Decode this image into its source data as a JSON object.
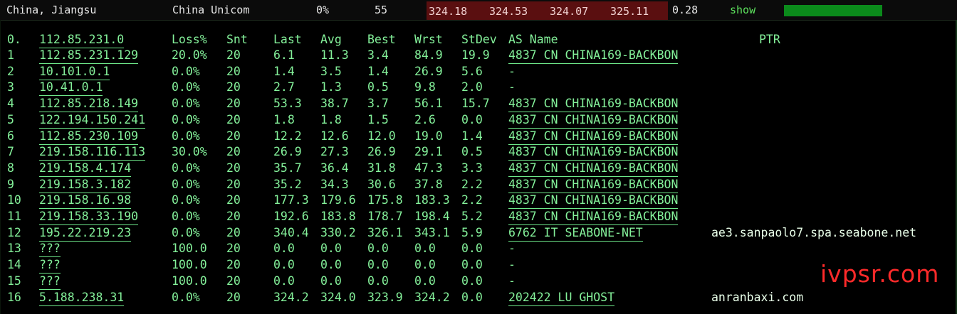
{
  "topbar": {
    "location": "China, Jiangsu",
    "isp": "China Unicom",
    "loss": "0%",
    "sent": "55",
    "pings": [
      "324.18",
      "324.53",
      "324.07",
      "325.11"
    ],
    "stdev": "0.28",
    "show_label": "show",
    "bar_fill": 1.0,
    "colors": {
      "ping_bg": "#5a0f10",
      "bar": "#0b8a1b",
      "text_green": "#5ee35e"
    }
  },
  "table": {
    "headers": {
      "num": "0.",
      "host": "112.85.231.0",
      "loss": "Loss%",
      "snt": "Snt",
      "last": "Last",
      "avg": "Avg",
      "best": "Best",
      "wrst": "Wrst",
      "stdev": "StDev",
      "asname": "AS Name",
      "ptr": "PTR"
    },
    "rows": [
      {
        "num": "1",
        "host": "112.85.231.129",
        "loss": "20.0%",
        "snt": "20",
        "last": "6.1",
        "avg": "11.3",
        "best": "3.4",
        "wrst": "84.9",
        "stdev": "19.9",
        "asname": "4837  CN CHINA169-BACKBON",
        "ptr": ""
      },
      {
        "num": "2",
        "host": "10.101.0.1",
        "loss": "0.0%",
        "snt": "20",
        "last": "1.4",
        "avg": "3.5",
        "best": "1.4",
        "wrst": "26.9",
        "stdev": "5.6",
        "asname": "-",
        "ptr": ""
      },
      {
        "num": "3",
        "host": "10.41.0.1",
        "loss": "0.0%",
        "snt": "20",
        "last": "2.7",
        "avg": "1.3",
        "best": "0.5",
        "wrst": "9.8",
        "stdev": "2.0",
        "asname": "-",
        "ptr": ""
      },
      {
        "num": "4",
        "host": "112.85.218.149",
        "loss": "0.0%",
        "snt": "20",
        "last": "53.3",
        "avg": "38.7",
        "best": "3.7",
        "wrst": "56.1",
        "stdev": "15.7",
        "asname": "4837  CN CHINA169-BACKBON",
        "ptr": ""
      },
      {
        "num": "5",
        "host": "122.194.150.241",
        "loss": "0.0%",
        "snt": "20",
        "last": "1.8",
        "avg": "1.8",
        "best": "1.5",
        "wrst": "2.6",
        "stdev": "0.0",
        "asname": "4837  CN CHINA169-BACKBON",
        "ptr": ""
      },
      {
        "num": "6",
        "host": "112.85.230.109",
        "loss": "0.0%",
        "snt": "20",
        "last": "12.2",
        "avg": "12.6",
        "best": "12.0",
        "wrst": "19.0",
        "stdev": "1.4",
        "asname": "4837  CN CHINA169-BACKBON",
        "ptr": ""
      },
      {
        "num": "7",
        "host": "219.158.116.113",
        "loss": "30.0%",
        "snt": "20",
        "last": "26.9",
        "avg": "27.3",
        "best": "26.9",
        "wrst": "29.1",
        "stdev": "0.5",
        "asname": "4837  CN CHINA169-BACKBON",
        "ptr": ""
      },
      {
        "num": "8",
        "host": "219.158.4.174",
        "loss": "0.0%",
        "snt": "20",
        "last": "35.7",
        "avg": "36.4",
        "best": "31.8",
        "wrst": "47.3",
        "stdev": "3.3",
        "asname": "4837  CN CHINA169-BACKBON",
        "ptr": ""
      },
      {
        "num": "9",
        "host": "219.158.3.182",
        "loss": "0.0%",
        "snt": "20",
        "last": "35.2",
        "avg": "34.3",
        "best": "30.6",
        "wrst": "37.8",
        "stdev": "2.2",
        "asname": "4837  CN CHINA169-BACKBON",
        "ptr": ""
      },
      {
        "num": "10",
        "host": "219.158.16.98",
        "loss": "0.0%",
        "snt": "20",
        "last": "177.3",
        "avg": "179.6",
        "best": "175.8",
        "wrst": "183.3",
        "stdev": "2.2",
        "asname": "4837  CN CHINA169-BACKBON",
        "ptr": ""
      },
      {
        "num": "11",
        "host": "219.158.33.190",
        "loss": "0.0%",
        "snt": "20",
        "last": "192.6",
        "avg": "183.8",
        "best": "178.7",
        "wrst": "198.4",
        "stdev": "5.2",
        "asname": "4837  CN CHINA169-BACKBON",
        "ptr": ""
      },
      {
        "num": "12",
        "host": "195.22.219.23",
        "loss": "0.0%",
        "snt": "20",
        "last": "340.4",
        "avg": "330.2",
        "best": "326.1",
        "wrst": "343.1",
        "stdev": "5.9",
        "asname": "6762  IT SEABONE-NET",
        "ptr": "ae3.sanpaolo7.spa.seabone.net"
      },
      {
        "num": "13",
        "host": "???",
        "loss": "100.0",
        "snt": "20",
        "last": "0.0",
        "avg": "0.0",
        "best": "0.0",
        "wrst": "0.0",
        "stdev": "0.0",
        "asname": "-",
        "ptr": ""
      },
      {
        "num": "14",
        "host": "???",
        "loss": "100.0",
        "snt": "20",
        "last": "0.0",
        "avg": "0.0",
        "best": "0.0",
        "wrst": "0.0",
        "stdev": "0.0",
        "asname": "-",
        "ptr": ""
      },
      {
        "num": "15",
        "host": "???",
        "loss": "100.0",
        "snt": "20",
        "last": "0.0",
        "avg": "0.0",
        "best": "0.0",
        "wrst": "0.0",
        "stdev": "0.0",
        "asname": "-",
        "ptr": ""
      },
      {
        "num": "16",
        "host": "5.188.238.31",
        "loss": "0.0%",
        "snt": "20",
        "last": "324.2",
        "avg": "324.0",
        "best": "323.9",
        "wrst": "324.2",
        "stdev": "0.0",
        "asname": "202422 LU GHOST",
        "ptr": "anranbaxi.com"
      }
    ]
  },
  "watermark": "ivpsr.com"
}
